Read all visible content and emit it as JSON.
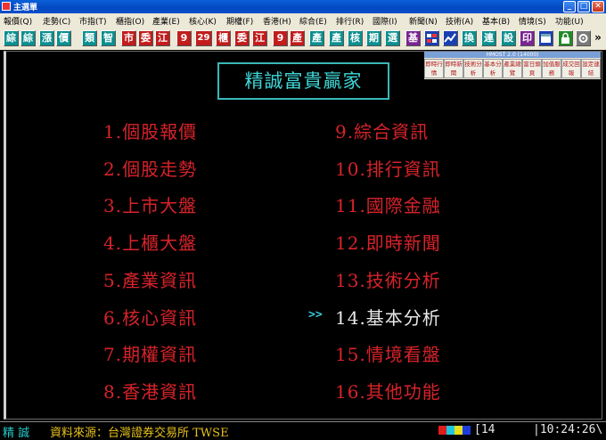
{
  "window": {
    "title": "主選單",
    "minimize": "_",
    "maximize": "□",
    "close": "✕"
  },
  "menubar": [
    "報價(Q)",
    "走勢(C)",
    "市指(T)",
    "櫃指(O)",
    "產業(E)",
    "核心(K)",
    "期權(F)",
    "香港(H)",
    "綜合(E)",
    "排行(R)",
    "國際(I)",
    "新聞(N)",
    "技術(A)",
    "基本(B)",
    "情境(S)",
    "功能(U)"
  ],
  "toolbar": [
    "綜",
    "綜",
    "漲",
    "價",
    "類",
    "智",
    "市",
    "委",
    "江",
    "9",
    "29",
    "櫃",
    "委",
    "江",
    "9",
    "產",
    "產",
    "產",
    "核",
    "期",
    "選",
    "基",
    "",
    "",
    "換",
    "連",
    "設",
    "印",
    "",
    "",
    "",
    "»"
  ],
  "mini_panel": {
    "title": "HMOST 2.0 (14000)",
    "buttons": [
      "即時行情",
      "即時新聞",
      "技術分析",
      "基本分析",
      "產業總覽",
      "當日頭頁",
      "加值服務",
      "成交回報",
      "設定連結"
    ]
  },
  "headline": "精誠富貴贏家",
  "left_menu": [
    "1.個股報價",
    "2.個股走勢",
    "3.上市大盤",
    "4.上櫃大盤",
    "5.產業資訊",
    "6.核心資訊",
    "7.期權資訊",
    "8.香港資訊"
  ],
  "right_menu": [
    "9.綜合資訊",
    "10.排行資訊",
    "11.國際金融",
    "12.即時新聞",
    "13.技術分析",
    "14.基本分析",
    "15.情境看盤",
    "16.其他功能"
  ],
  "pointer": ">>",
  "status": {
    "brand": "精 誠",
    "source": "資料來源：台灣證券交易所 TWSE",
    "code": "[14",
    "time": "|10:24:26\\",
    "colors": [
      "#e01c1c",
      "#1cc8e0",
      "#e8e01c",
      "#1c3ce0"
    ]
  }
}
